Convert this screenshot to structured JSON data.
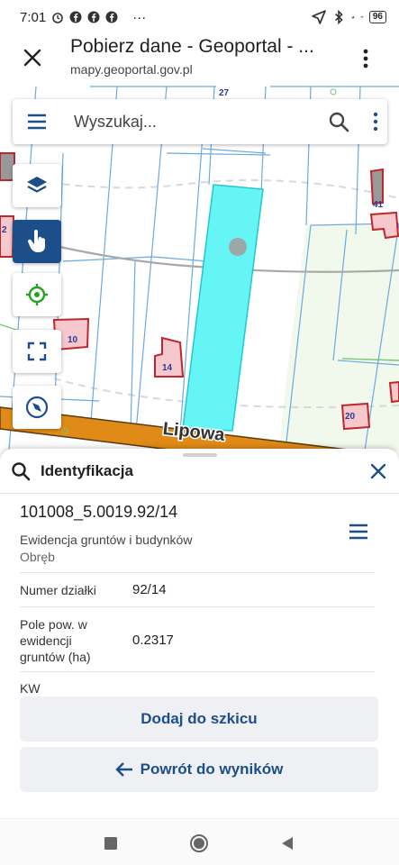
{
  "status_bar": {
    "time": "7:01",
    "dots": "···",
    "battery": "96"
  },
  "browser": {
    "title": "Pobierz dane - Geoportal - ...",
    "url": "mapy.geoportal.gov.pl"
  },
  "search": {
    "placeholder": "Wyszukaj..."
  },
  "map": {
    "street_name": "Lipowa",
    "building_labels": [
      "10",
      "14",
      "41",
      "20",
      "2",
      "27"
    ]
  },
  "panel": {
    "title": "Identyfikacja",
    "record_id": "101008_5.0019.92/14",
    "record_source": "Ewidencja gruntów i budynków",
    "attributes": [
      {
        "key": "Obręb",
        "value": ""
      },
      {
        "key": "Numer działki",
        "value": "92/14"
      },
      {
        "key": "Pole pow. w ewidencji gruntów (ha)",
        "value": "0.2317"
      },
      {
        "key": "KW",
        "value": ""
      }
    ],
    "add_button": "Dodaj do szkicu",
    "back_button": "Powrót do wyników"
  },
  "colors": {
    "accent": "#1c4f8a",
    "parcel_highlight": "#66f5f5",
    "road": "#e08a17",
    "parcel_border": "#6aaae0",
    "building_border": "#c0262b",
    "building_fill": "#f4c8cc"
  }
}
